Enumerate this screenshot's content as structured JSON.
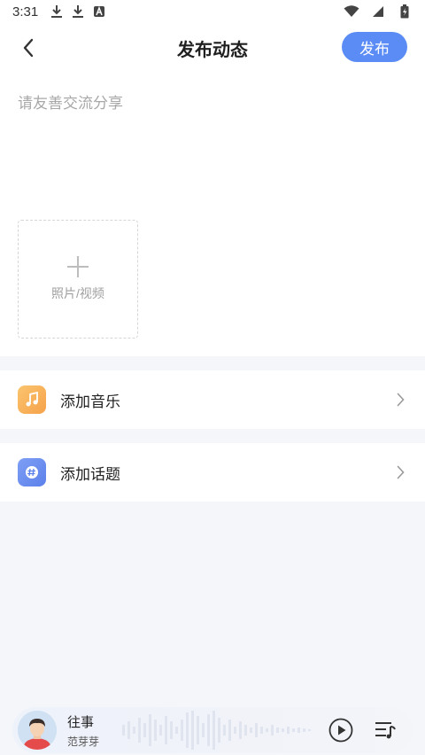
{
  "status_bar": {
    "time": "3:31",
    "icons": [
      "download-icon",
      "download-icon",
      "a-box-icon",
      "wifi-icon",
      "signal-icon",
      "battery-icon"
    ]
  },
  "header": {
    "title": "发布动态",
    "publish_label": "发布",
    "back_icon": "back-arrow-icon"
  },
  "editor": {
    "placeholder": "请友善交流分享",
    "value": ""
  },
  "media_upload": {
    "label": "照片/视频",
    "icon": "plus-icon"
  },
  "options": [
    {
      "label": "添加音乐",
      "icon": "music-note-icon",
      "color": "#f7b15a"
    },
    {
      "label": "添加话题",
      "icon": "hashtag-icon",
      "color": "#6d8ff0"
    }
  ],
  "player": {
    "title": "往事",
    "artist": "范芽芽",
    "play_icon": "play-icon",
    "playlist_icon": "playlist-icon"
  },
  "colors": {
    "accent": "#5b8cf5",
    "page_bg": "#f5f6fa",
    "placeholder": "#a8a8a8"
  }
}
